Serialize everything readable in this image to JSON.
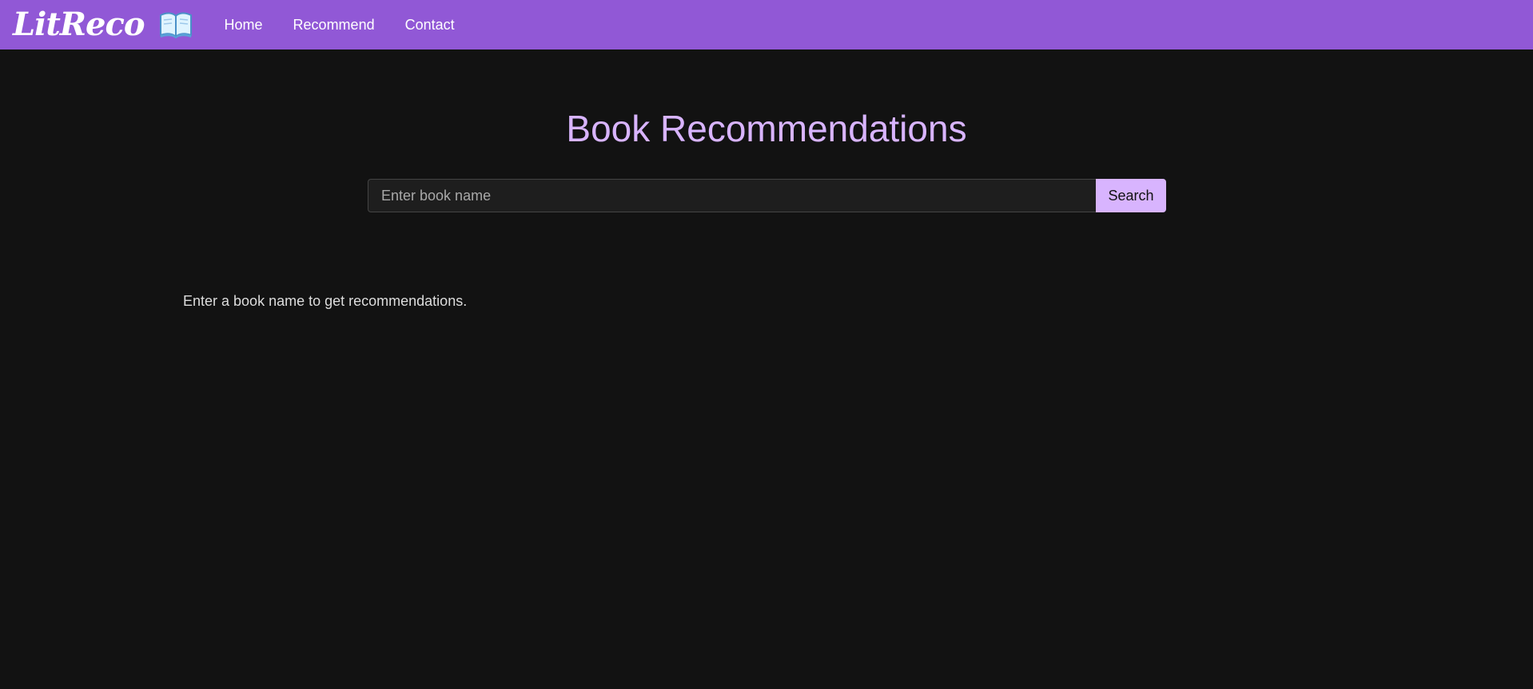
{
  "navbar": {
    "brand": "LitReco",
    "brand_icon": "open-book-icon",
    "background": "#9158d6",
    "links": [
      {
        "label": "Home"
      },
      {
        "label": "Recommend"
      },
      {
        "label": "Contact"
      }
    ]
  },
  "main": {
    "title": "Book Recommendations",
    "title_color": "#d8b4fe",
    "search": {
      "placeholder": "Enter book name",
      "value": "",
      "button_label": "Search",
      "button_color": "#d8b4fe"
    },
    "hint": "Enter a book name to get recommendations."
  },
  "colors": {
    "page_background": "#121212",
    "input_background": "#1e1e1e"
  }
}
